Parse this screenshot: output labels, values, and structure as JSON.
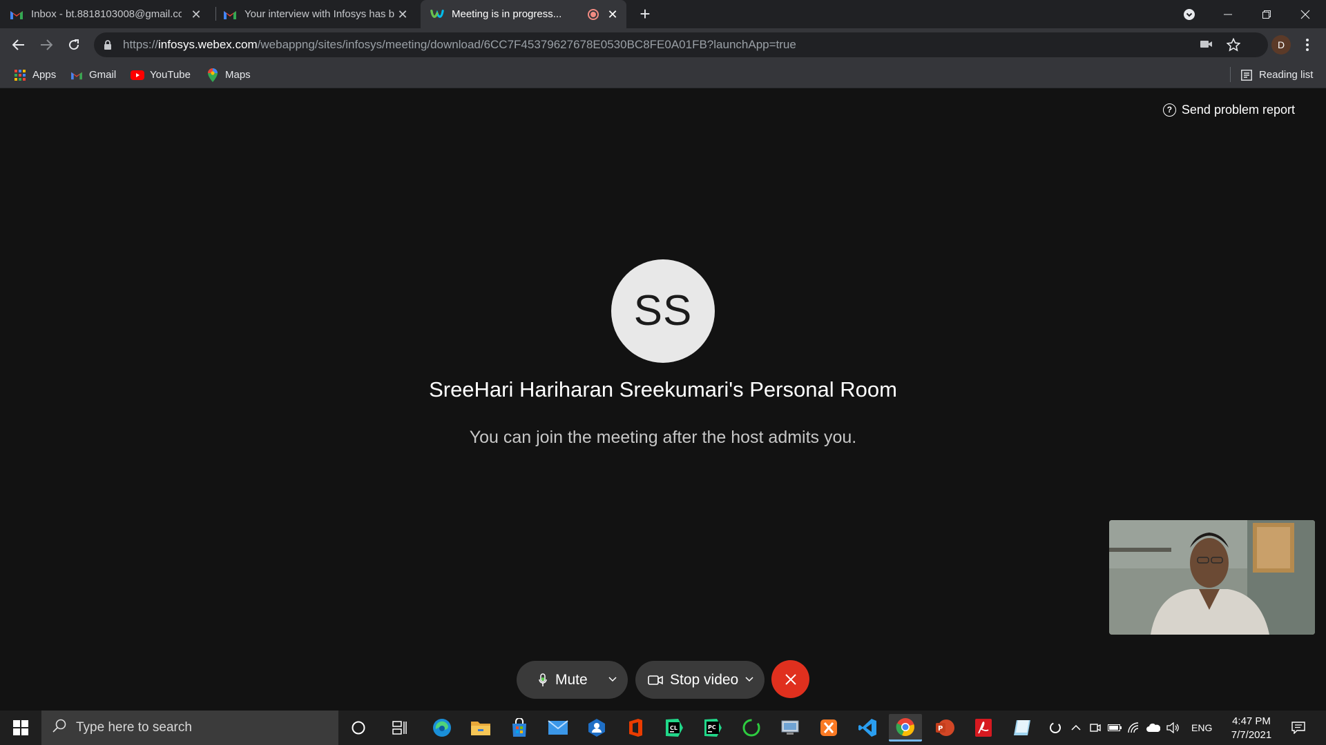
{
  "browser": {
    "tabs": [
      {
        "title": "Inbox - bt.8818103008@gmail.co",
        "icon": "gmail-icon"
      },
      {
        "title": "Your interview with Infosys has b",
        "icon": "gmail-icon"
      },
      {
        "title": "Meeting is in progress...",
        "icon": "webex-icon",
        "active": true
      }
    ],
    "new_tab": "+",
    "url_host": "infosys.webex.com",
    "url_prefix": "https://",
    "url_path": "/webappng/sites/infosys/meeting/download/6CC7F45379627678E0530BC8FE0A01FB?launchApp=true",
    "profile_initial": "D"
  },
  "bookmarks": {
    "items": [
      {
        "label": "Apps",
        "icon": "apps-grid-icon"
      },
      {
        "label": "Gmail",
        "icon": "gmail-icon"
      },
      {
        "label": "YouTube",
        "icon": "youtube-icon"
      },
      {
        "label": "Maps",
        "icon": "maps-pin-icon"
      }
    ],
    "reading_list": "Reading list"
  },
  "meeting": {
    "report_label": "Send problem report",
    "avatar_initials": "SS",
    "room_title": "SreeHari Hariharan Sreekumari's Personal Room",
    "subtitle": "You can join the meeting after the host admits you.",
    "controls": {
      "mute_label": "Mute",
      "video_label": "Stop video",
      "leave_icon": "close-icon"
    }
  },
  "taskbar": {
    "search_placeholder": "Type here to search",
    "language": "ENG",
    "time": "4:47 PM",
    "date": "7/7/2021"
  },
  "colors": {
    "background": "#121212",
    "leave": "#e0301e",
    "control": "#3a3a3a"
  }
}
